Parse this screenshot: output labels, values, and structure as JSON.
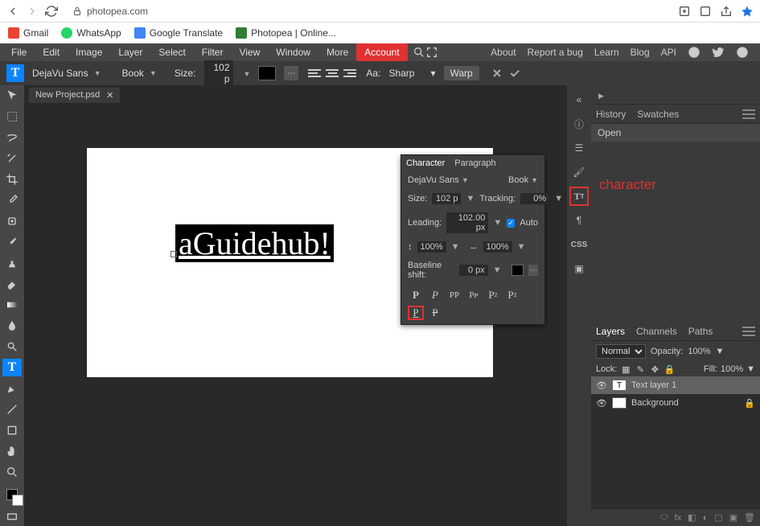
{
  "browser": {
    "url": "photopea.com",
    "bookmarks": [
      {
        "label": "Gmail",
        "color": "#ea4335"
      },
      {
        "label": "WhatsApp",
        "color": "#25d366"
      },
      {
        "label": "Google Translate",
        "color": "#4285f4"
      },
      {
        "label": "Photopea | Online...",
        "color": "#2e7d32"
      }
    ]
  },
  "menubar": {
    "items": [
      "File",
      "Edit",
      "Image",
      "Layer",
      "Select",
      "Filter",
      "View",
      "Window",
      "More"
    ],
    "account": "Account",
    "right": [
      "About",
      "Report a bug",
      "Learn",
      "Blog",
      "API"
    ]
  },
  "options": {
    "font": "DejaVu Sans",
    "weight": "Book",
    "size_label": "Size:",
    "size": "102 p",
    "aa_label": "Aa:",
    "aa": "Sharp",
    "warp": "Warp"
  },
  "doc": {
    "tab": "New Project.psd",
    "text": "aGuidehub!"
  },
  "char": {
    "tab_char": "Character",
    "tab_para": "Paragraph",
    "font": "DejaVu Sans",
    "weight": "Book",
    "size_label": "Size:",
    "size": "102 p",
    "tracking_label": "Tracking:",
    "tracking": "0%",
    "leading_label": "Leading:",
    "leading": "102.00 px",
    "auto": "Auto",
    "vscale": "100%",
    "hscale": "100%",
    "baseline_label": "Baseline shift:",
    "baseline": "0 px"
  },
  "iconstrip_css": "CSS",
  "annot": "character",
  "history": {
    "tab_history": "History",
    "tab_swatches": "Swatches",
    "open": "Open"
  },
  "layers": {
    "tab_layers": "Layers",
    "tab_channels": "Channels",
    "tab_paths": "Paths",
    "blend": "Normal",
    "opacity_label": "Opacity:",
    "opacity": "100%",
    "lock_label": "Lock:",
    "fill_label": "Fill:",
    "fill": "100%",
    "layer1": "Text layer 1",
    "layer_bg": "Background"
  }
}
